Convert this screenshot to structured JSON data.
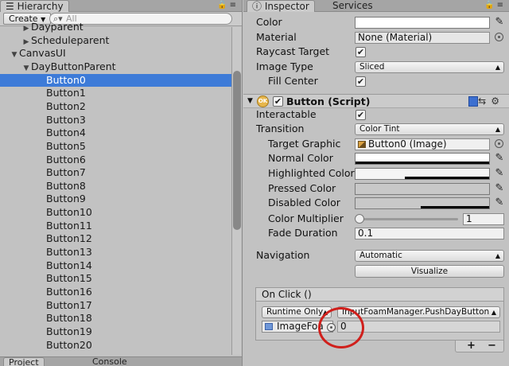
{
  "hierarchy": {
    "tab_label": "Hierarchy",
    "create_label": "Create",
    "search_placeholder": "All",
    "rows": [
      {
        "label": "Dayparent",
        "depth": 2,
        "arrow": "▶"
      },
      {
        "label": "Scheduleparent",
        "depth": 2,
        "arrow": "▶"
      },
      {
        "label": "CanvasUI",
        "depth": 1,
        "arrow": "▼"
      },
      {
        "label": "DayButtonParent",
        "depth": 2,
        "arrow": "▼"
      },
      {
        "label": "Button0",
        "depth": 3,
        "arrow": "",
        "selected": true
      },
      {
        "label": "Button1",
        "depth": 3,
        "arrow": ""
      },
      {
        "label": "Button2",
        "depth": 3,
        "arrow": ""
      },
      {
        "label": "Button3",
        "depth": 3,
        "arrow": ""
      },
      {
        "label": "Button4",
        "depth": 3,
        "arrow": ""
      },
      {
        "label": "Button5",
        "depth": 3,
        "arrow": ""
      },
      {
        "label": "Button6",
        "depth": 3,
        "arrow": ""
      },
      {
        "label": "Button7",
        "depth": 3,
        "arrow": ""
      },
      {
        "label": "Button8",
        "depth": 3,
        "arrow": ""
      },
      {
        "label": "Button9",
        "depth": 3,
        "arrow": ""
      },
      {
        "label": "Button10",
        "depth": 3,
        "arrow": ""
      },
      {
        "label": "Button11",
        "depth": 3,
        "arrow": ""
      },
      {
        "label": "Button12",
        "depth": 3,
        "arrow": ""
      },
      {
        "label": "Button13",
        "depth": 3,
        "arrow": ""
      },
      {
        "label": "Button14",
        "depth": 3,
        "arrow": ""
      },
      {
        "label": "Button15",
        "depth": 3,
        "arrow": ""
      },
      {
        "label": "Button16",
        "depth": 3,
        "arrow": ""
      },
      {
        "label": "Button17",
        "depth": 3,
        "arrow": ""
      },
      {
        "label": "Button18",
        "depth": 3,
        "arrow": ""
      },
      {
        "label": "Button19",
        "depth": 3,
        "arrow": ""
      },
      {
        "label": "Button20",
        "depth": 3,
        "arrow": ""
      }
    ],
    "bottom_tabs": [
      "Project",
      "Console"
    ]
  },
  "inspector": {
    "tabs": [
      "Inspector",
      "Services"
    ],
    "image": {
      "color_label": "Color",
      "material_label": "Material",
      "material_value": "None (Material)",
      "raycast_label": "Raycast Target",
      "image_type_label": "Image Type",
      "image_type_value": "Sliced",
      "fill_center_label": "Fill Center"
    },
    "button": {
      "title": "Button (Script)",
      "icon_text": "OK",
      "interactable_label": "Interactable",
      "transition_label": "Transition",
      "transition_value": "Color Tint",
      "target_graphic_label": "Target Graphic",
      "target_graphic_value": "Button0 (Image)",
      "normal_color_label": "Normal Color",
      "highlighted_color_label": "Highlighted Color",
      "pressed_color_label": "Pressed Color",
      "disabled_color_label": "Disabled Color",
      "color_multiplier_label": "Color Multiplier",
      "color_multiplier_value": "1",
      "fade_duration_label": "Fade Duration",
      "fade_duration_value": "0.1",
      "navigation_label": "Navigation",
      "navigation_value": "Automatic",
      "visualize_label": "Visualize"
    },
    "on_click": {
      "header": "On Click ()",
      "runtime_value": "Runtime Only",
      "function_value": "InputFoamManager.PushDayButton",
      "object_value": "ImageFoa",
      "argument_value": "0",
      "plus": "+",
      "minus": "−"
    }
  },
  "colors": {
    "selection": "#3d7bd8",
    "panel_bg": "#c2c2c2",
    "annotation_circle": "#d0201c"
  }
}
